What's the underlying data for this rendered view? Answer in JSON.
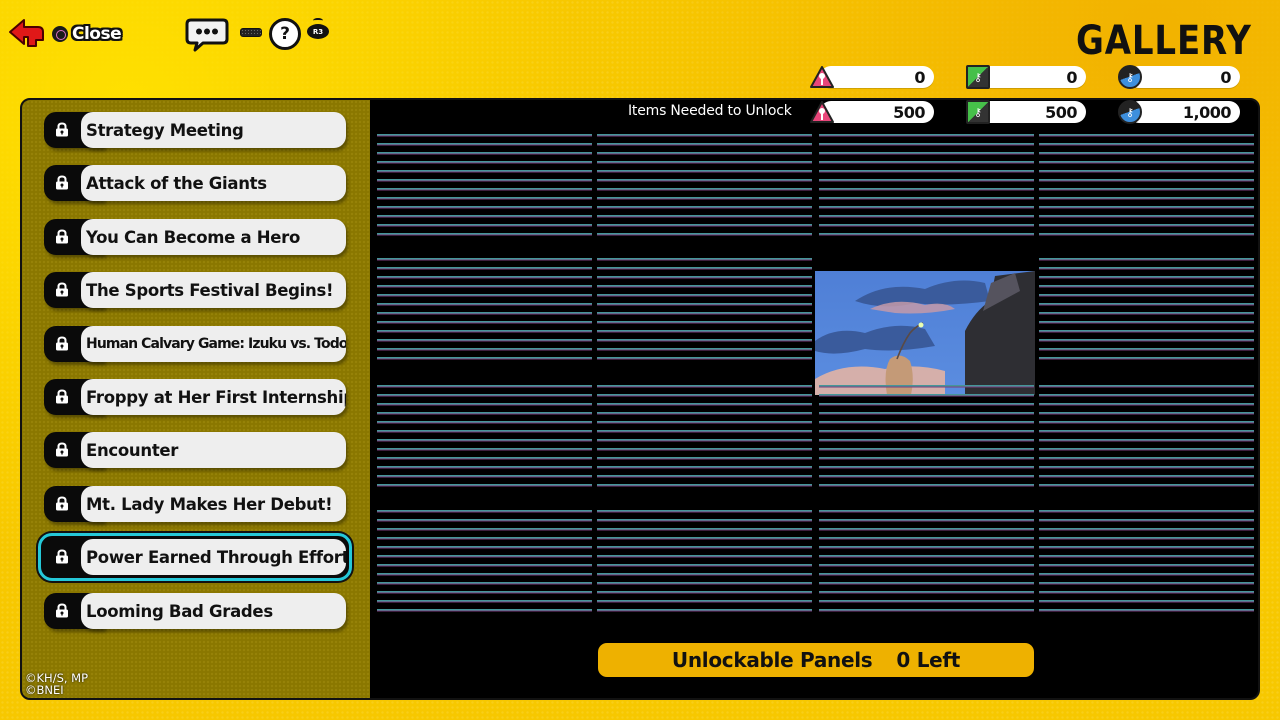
{
  "top_bar": {
    "back_icon": "red-back-arrow",
    "close_label": "Close",
    "close_button_glyph": "circle-button",
    "chat_icon": "speech-bubble",
    "keyboard_icon": "keyboard",
    "help_icon_glyph": "?",
    "r3_label": "R3"
  },
  "title": "GALLERY",
  "currency": {
    "owned": [
      {
        "type": "triangle-key",
        "value": "0",
        "color": "#e8467a"
      },
      {
        "type": "square-key",
        "value": "0",
        "color": "#46c04a"
      },
      {
        "type": "circle-key",
        "value": "0",
        "color": "#3d8fdd"
      }
    ],
    "needed_label": "Items Needed to Unlock",
    "needed": [
      {
        "type": "triangle-key",
        "value": "500",
        "color": "#e8467a"
      },
      {
        "type": "square-key",
        "value": "500",
        "color": "#46c04a"
      },
      {
        "type": "circle-key",
        "value": "1,000",
        "color": "#3d8fdd"
      }
    ]
  },
  "scenes": [
    {
      "label": "Strategy Meeting",
      "locked": true,
      "selected": false
    },
    {
      "label": "Attack of the Giants",
      "locked": true,
      "selected": false
    },
    {
      "label": "You Can Become a Hero",
      "locked": true,
      "selected": false
    },
    {
      "label": "The Sports Festival Begins!",
      "locked": true,
      "selected": false
    },
    {
      "label": "Human Calvary Game: Izuku vs. Todoroki",
      "locked": true,
      "selected": false
    },
    {
      "label": "Froppy at Her First Internship",
      "locked": true,
      "selected": false
    },
    {
      "label": "Encounter",
      "locked": true,
      "selected": false
    },
    {
      "label": "Mt. Lady Makes Her Debut!",
      "locked": true,
      "selected": false
    },
    {
      "label": "Power Earned Through Effort",
      "locked": true,
      "selected": true
    },
    {
      "label": "Looming Bad Grades",
      "locked": true,
      "selected": false
    }
  ],
  "panels": {
    "rows": 4,
    "cols": 4,
    "unlocked": [
      {
        "row": 2,
        "col": 3,
        "description": "Hand holding a sparkling strand against a blue evening sky"
      }
    ]
  },
  "copyright": [
    "©KH/S, MP",
    "©BNEI"
  ],
  "status": {
    "label": "Unlockable Panels",
    "value": "0 Left"
  },
  "colors": {
    "background_yellow": "#f7c800",
    "sidebar_olive": "#8a7700",
    "selection_cyan": "#25c8d8",
    "status_bar": "#eeb100"
  }
}
